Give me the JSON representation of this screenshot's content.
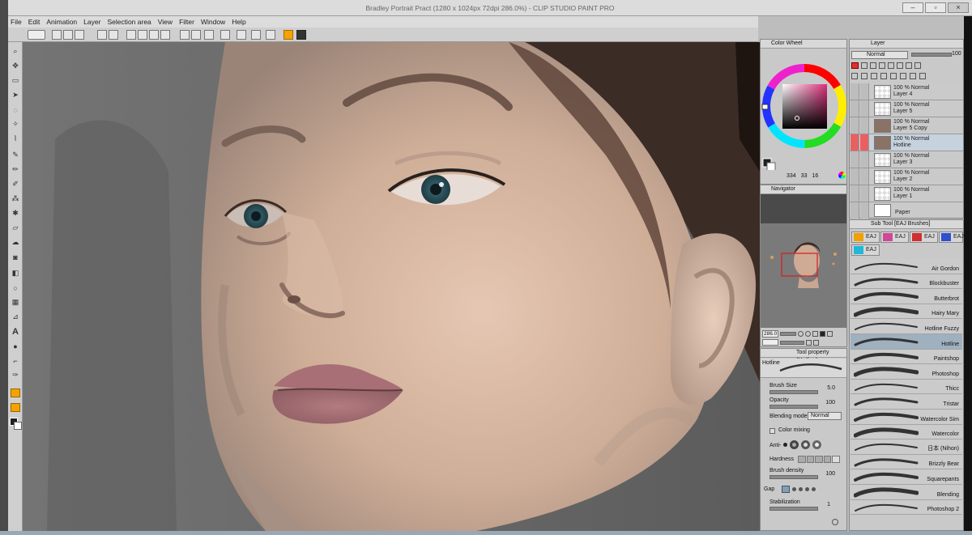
{
  "window": {
    "title": "Bradley Portrait Pract (1280 x 1024px 72dpi 286.0%) - CLIP STUDIO PAINT PRO"
  },
  "menu": [
    "File",
    "Edit",
    "Animation",
    "Layer",
    "Selection area",
    "View",
    "Filter",
    "Window",
    "Help"
  ],
  "color_wheel": {
    "title": "Color Wheel",
    "h": "334",
    "s": "33",
    "v": "16",
    "main_color": "#1f1f1f",
    "accent_color": "#c04878"
  },
  "navigator": {
    "title": "Navigator",
    "zoom": "286.0"
  },
  "tool_property": {
    "title": "Tool property (Hotline)",
    "brush_name": "Hotline",
    "brush_size_label": "Brush Size",
    "brush_size_value": "5.0",
    "opacity_label": "Opacity",
    "opacity_value": "100",
    "blending_mode_label": "Blending mode",
    "blending_mode_value": "Normal",
    "color_mixing_label": "Color mixing",
    "anti_aliasing_label": "Anti-",
    "hardness_label": "Hardness",
    "brush_density_label": "Brush density",
    "brush_density_value": "100",
    "gap_label": "Gap",
    "stabilization_label": "Stabilization",
    "stabilization_value": "1"
  },
  "layer_panel": {
    "title": "Layer",
    "blend_mode": "Normal",
    "opacity": "100",
    "layers": [
      {
        "mode": "100 % Normal",
        "name": "Layer 4",
        "selected": false
      },
      {
        "mode": "100 % Normal",
        "name": "Layer 5",
        "selected": false
      },
      {
        "mode": "100 % Normal",
        "name": "Layer 5 Copy",
        "selected": false
      },
      {
        "mode": "100 % Normal",
        "name": "Hotline",
        "selected": true
      },
      {
        "mode": "100 % Normal",
        "name": "Layer 3",
        "selected": false
      },
      {
        "mode": "100 % Normal",
        "name": "Layer 2",
        "selected": false
      },
      {
        "mode": "100 % Normal",
        "name": "Layer 1",
        "selected": false
      }
    ],
    "paper_label": "Paper"
  },
  "sub_tool": {
    "title": "Sub Tool [EAJ Brushes]",
    "groups": [
      {
        "label": "EAJ",
        "color": "#f0a000"
      },
      {
        "label": "EAJ",
        "color": "#d04898"
      },
      {
        "label": "EAJ",
        "color": "#d03030"
      },
      {
        "label": "EAJ",
        "color": "#3050d0"
      },
      {
        "label": "EAJ",
        "color": "#20b8d8"
      }
    ],
    "brushes": [
      "Air Gordon",
      "Blockbuster",
      "Butterbrot",
      "Hairy Mary",
      "Hotline Fuzzy",
      "Hotline",
      "Paintshop",
      "Photoshop",
      "Thicc",
      "Tristar",
      "Watercolor Sim",
      "Watercolor",
      "日本 (Nihon)",
      "Brizzly Bear",
      "Squarepants",
      "Blending",
      "Photoshop 2"
    ],
    "selected_brush": "Hotline"
  }
}
